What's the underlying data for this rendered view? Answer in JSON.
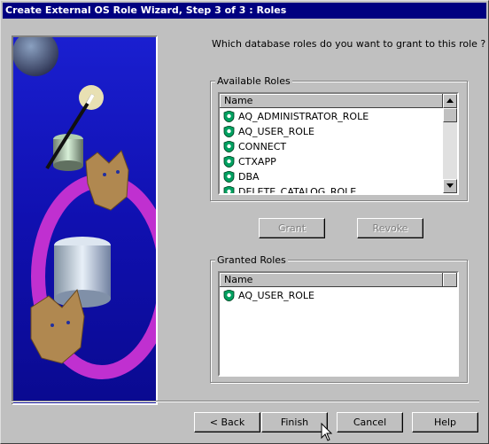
{
  "window": {
    "title": "Create External OS Role Wizard, Step 3 of 3 : Roles"
  },
  "question": "Which database roles do you want to grant to this role ?",
  "available": {
    "group_label": "Available Roles",
    "column_header": "Name",
    "items": [
      {
        "label": "AQ_ADMINISTRATOR_ROLE",
        "icon": "role-icon"
      },
      {
        "label": "AQ_USER_ROLE",
        "icon": "role-icon"
      },
      {
        "label": "CONNECT",
        "icon": "role-icon"
      },
      {
        "label": "CTXAPP",
        "icon": "role-icon"
      },
      {
        "label": "DBA",
        "icon": "role-icon"
      },
      {
        "label": "DELETE_CATALOG_ROLE",
        "icon": "role-icon"
      }
    ]
  },
  "granted": {
    "group_label": "Granted Roles",
    "column_header": "Name",
    "items": [
      {
        "label": "AQ_USER_ROLE",
        "icon": "role-icon"
      }
    ]
  },
  "actions": {
    "grant": "Grant",
    "revoke": "Revoke"
  },
  "footer": {
    "back": "< Back",
    "finish": "Finish",
    "cancel": "Cancel",
    "help": "Help"
  },
  "colors": {
    "titlebar": "#000080",
    "face": "#c0c0c0",
    "role_icon_green": "#00a060"
  }
}
